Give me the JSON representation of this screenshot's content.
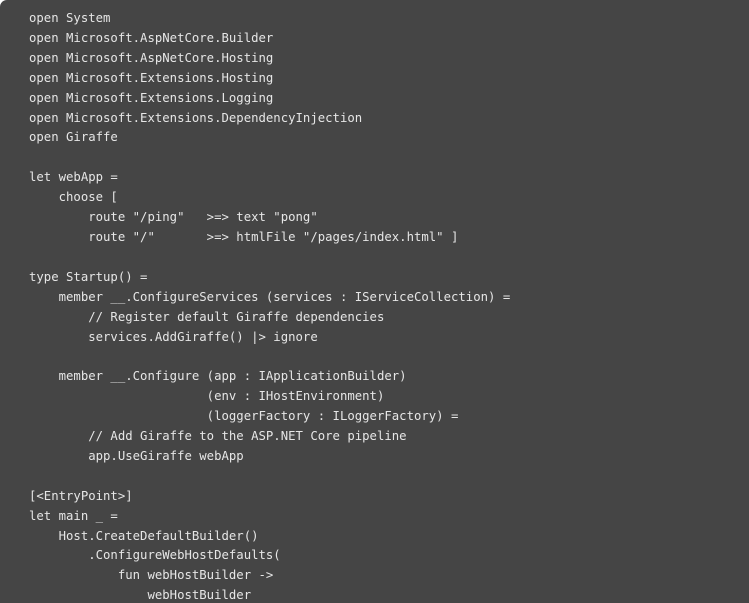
{
  "editor": {
    "language": "F#",
    "background_color": "#454545",
    "text_color": "#e6e6e6",
    "page_color": "#ffffff",
    "font_size_px": 12.3,
    "line_height_px": 19.92,
    "indent_size": 4,
    "total_lines": 30,
    "last_line_clipped": true
  },
  "code": {
    "lines": [
      "open System",
      "open Microsoft.AspNetCore.Builder",
      "open Microsoft.AspNetCore.Hosting",
      "open Microsoft.Extensions.Hosting",
      "open Microsoft.Extensions.Logging",
      "open Microsoft.Extensions.DependencyInjection",
      "open Giraffe",
      "",
      "let webApp =",
      "    choose [",
      "        route \"/ping\"   >=> text \"pong\"",
      "        route \"/\"       >=> htmlFile \"/pages/index.html\" ]",
      "",
      "type Startup() =",
      "    member __.ConfigureServices (services : IServiceCollection) =",
      "        // Register default Giraffe dependencies",
      "        services.AddGiraffe() |> ignore",
      "",
      "    member __.Configure (app : IApplicationBuilder)",
      "                        (env : IHostEnvironment)",
      "                        (loggerFactory : ILoggerFactory) =",
      "        // Add Giraffe to the ASP.NET Core pipeline",
      "        app.UseGiraffe webApp",
      "",
      "[<EntryPoint>]",
      "let main _ =",
      "    Host.CreateDefaultBuilder()",
      "        .ConfigureWebHostDefaults(",
      "            fun webHostBuilder ->",
      "                webHostBuilder"
    ]
  }
}
